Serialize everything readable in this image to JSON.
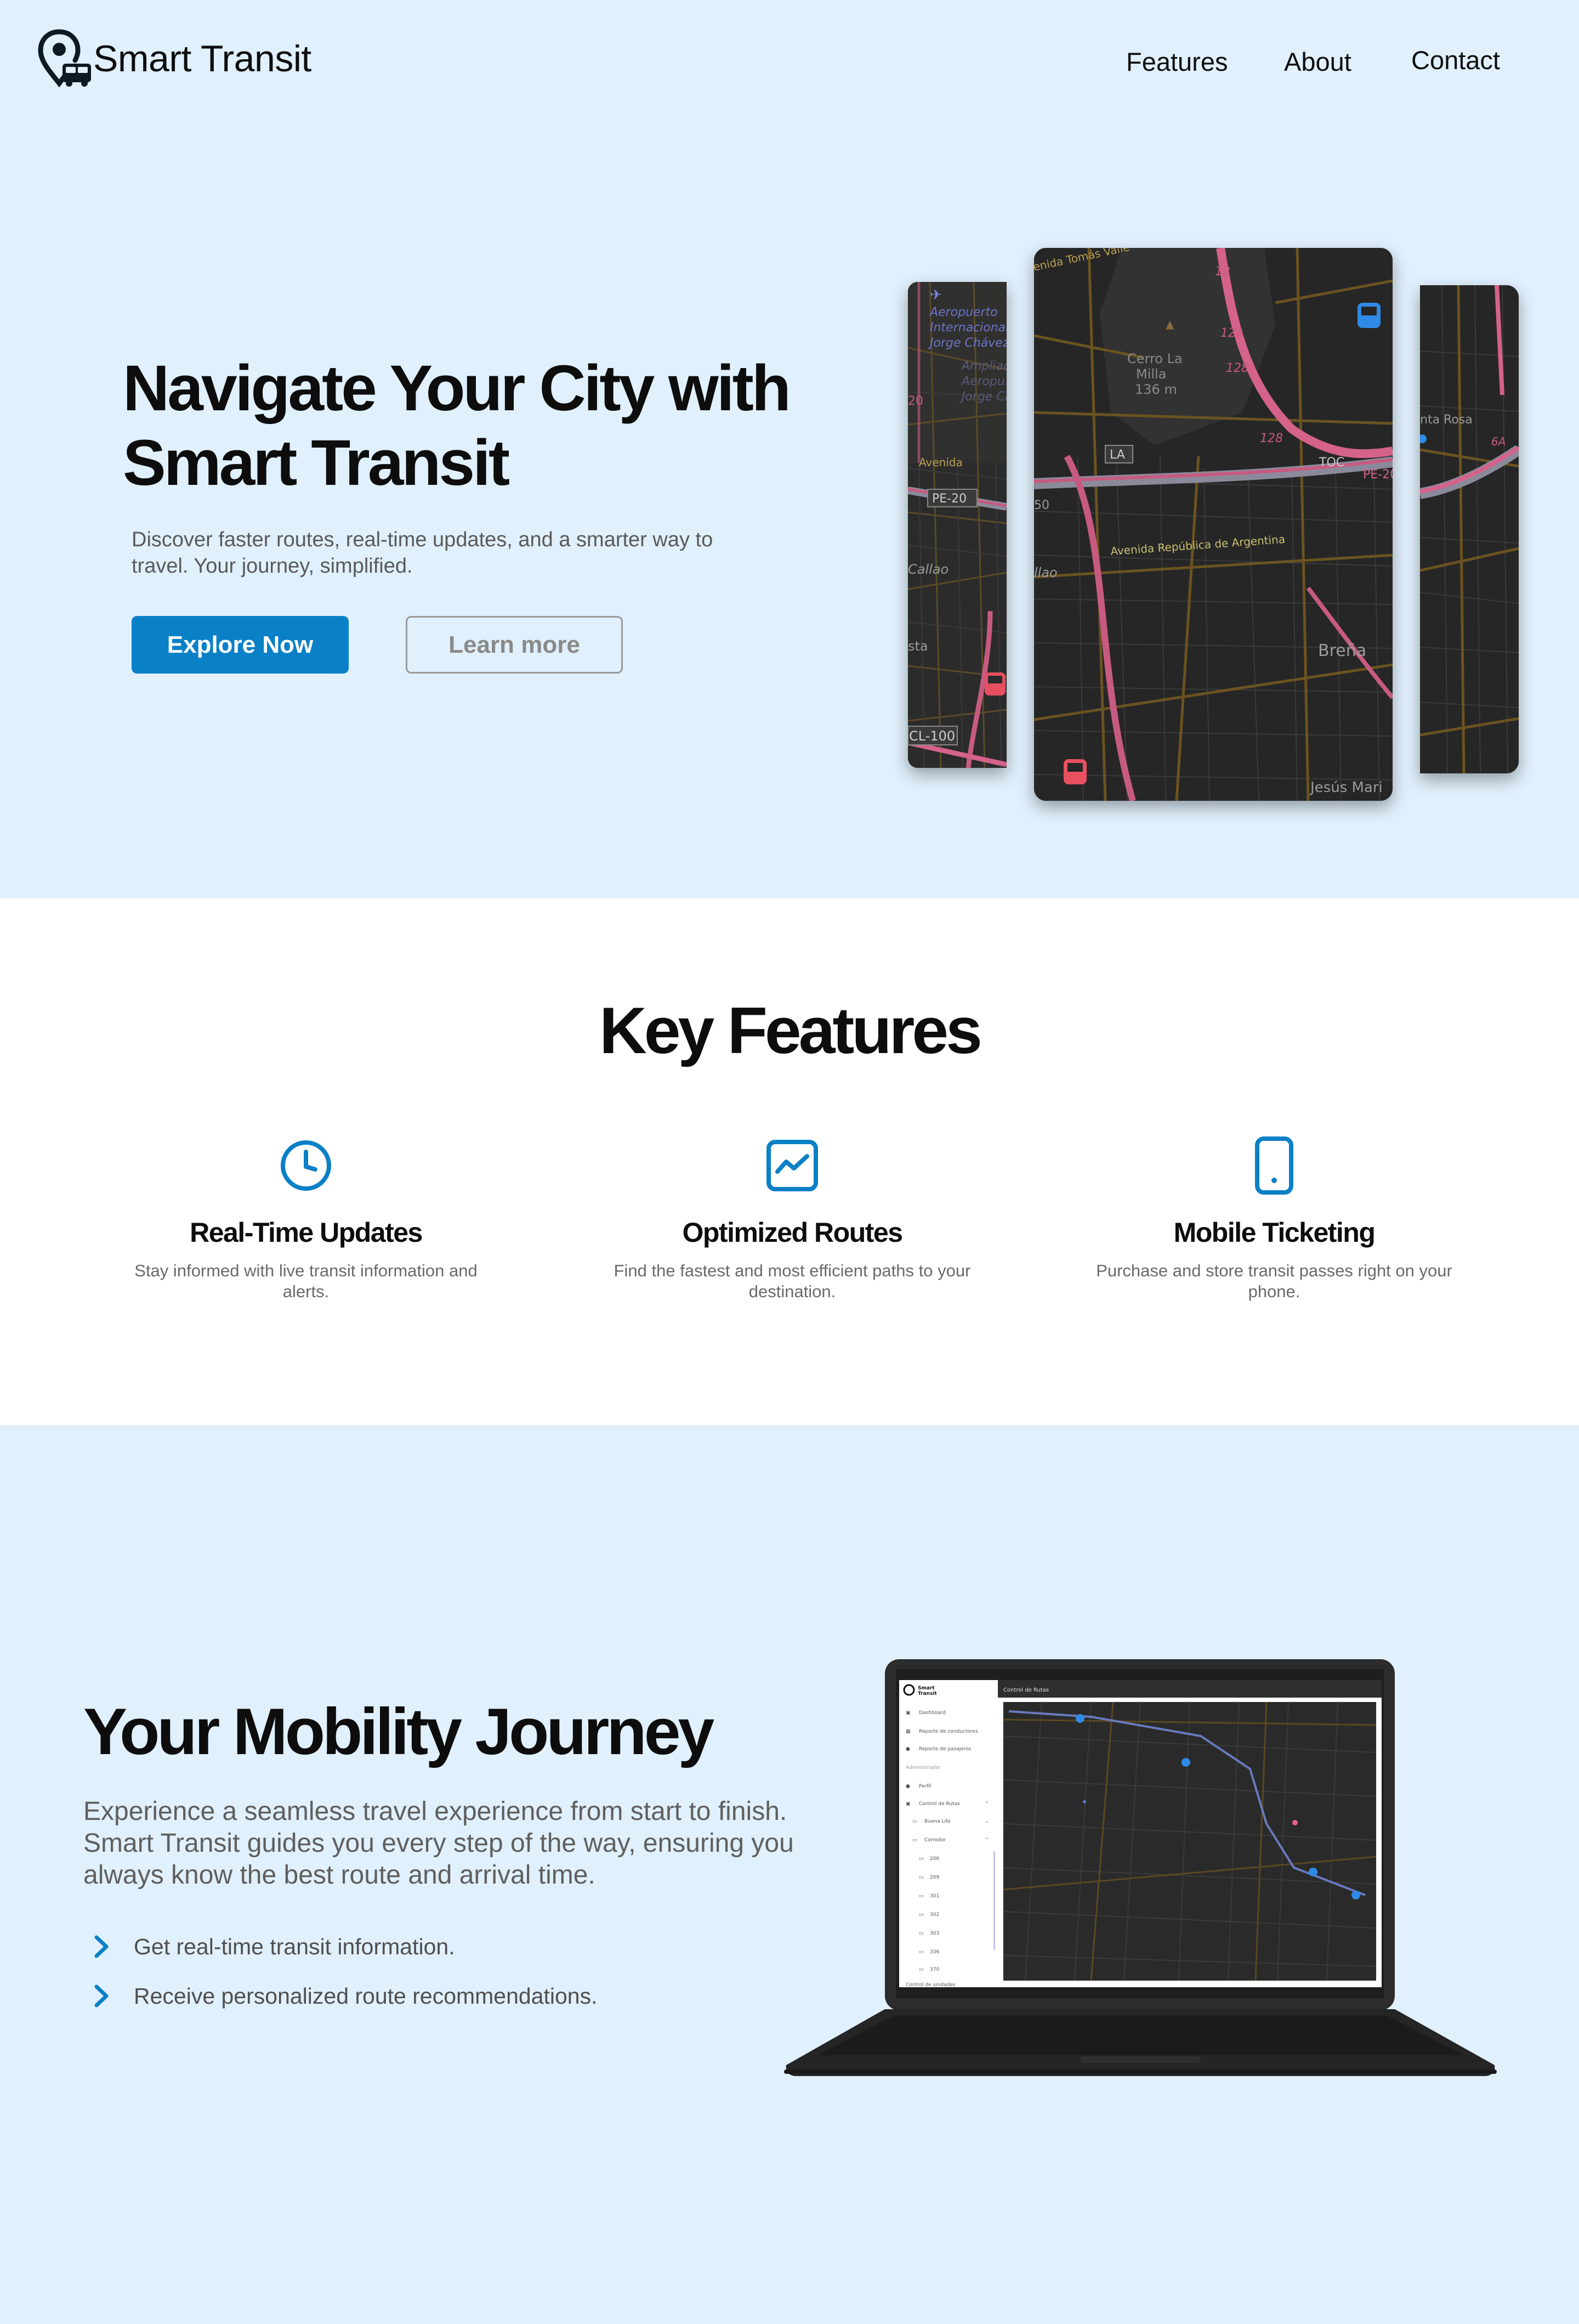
{
  "brand": {
    "name": "Smart Transit",
    "logo_icon": "bus-location-pin-icon"
  },
  "nav": {
    "links": [
      "Features",
      "About",
      "Contact"
    ]
  },
  "hero": {
    "title_line1": "Navigate Your City with",
    "title_line2": "Smart Transit",
    "subtitle": "Discover faster routes, real-time updates, and a smarter way to travel. Your journey, simplified.",
    "primary_button": "Explore Now",
    "secondary_button": "Learn more",
    "map_labels": {
      "left": [
        "Aeropuerto",
        "Internacional",
        "Jorge Chávez",
        "Ampliac",
        "Aeropu",
        "Jorge Ch",
        "20",
        "Avenida",
        "PE-20",
        "Callao",
        "sta",
        "CL-100"
      ],
      "center": [
        "enida Tomás Valle",
        "12",
        "12A",
        "Cerro La",
        "Milla",
        "136 m",
        "128",
        "128",
        "LA",
        "TOC",
        "PE-20",
        "50",
        "Avenida República de Argentina",
        "llao",
        "Breña",
        "Jesús Mari"
      ],
      "right": [
        "nta Rosa",
        "6A"
      ]
    }
  },
  "features": {
    "title": "Key Features",
    "items": [
      {
        "icon": "clock-icon",
        "title": "Real-Time Updates",
        "description": "Stay informed with live transit information and alerts."
      },
      {
        "icon": "route-chart-icon",
        "title": "Optimized Routes",
        "description": "Find the fastest and most efficient paths to your destination."
      },
      {
        "icon": "smartphone-icon",
        "title": "Mobile Ticketing",
        "description": "Purchase and store transit passes right on your phone."
      }
    ]
  },
  "journey": {
    "title": "Your Mobility Journey",
    "description": "Experience a seamless travel experience from start to finish. Smart Transit guides you every step of the way, ensuring you always know the best route and arrival time.",
    "bullets": [
      "Get real-time transit information.",
      "Receive personalized route recommendations."
    ],
    "laptop_screen": {
      "brand_line1": "Smart",
      "brand_line2": "Transit",
      "header": "Control de Rutas",
      "menu": [
        "Dashboard",
        "Reporte de conductores",
        "Reporte de pasajeros",
        "Administrador",
        "Perfil",
        "Control de Rutas",
        "Buena Life",
        "Corredor"
      ],
      "route_codes": [
        "206",
        "209",
        "301",
        "302",
        "303",
        "336",
        "370"
      ],
      "menu_last": "Control de unidades"
    }
  },
  "colors": {
    "accent": "#0a80c6",
    "background": "#e0f0fc",
    "section_white": "#ffffff",
    "text": "#0d0d0d",
    "muted": "#5a5a5a",
    "map_bus_red": "#e85060",
    "map_bus_blue": "#2f8ae6"
  }
}
